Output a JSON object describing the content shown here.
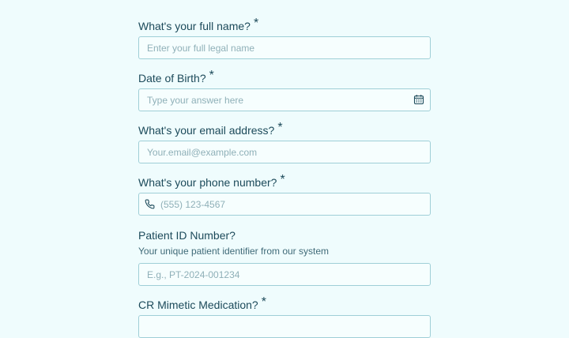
{
  "fields": [
    {
      "label": "What's your full name?",
      "required": "*",
      "placeholder": "Enter your full legal name"
    },
    {
      "label": "Date of Birth?",
      "required": "*",
      "placeholder": "Type your answer here",
      "icon": "calendar-icon"
    },
    {
      "label": "What's your email address?",
      "required": "*",
      "placeholder": "Your.email@example.com"
    },
    {
      "label": "What's your phone number?",
      "required": "*",
      "placeholder": "(555) 123-4567",
      "icon": "phone-icon"
    },
    {
      "label": "Patient ID Number?",
      "help": "Your unique patient identifier from our system",
      "placeholder": "E.g., PT-2024-001234"
    },
    {
      "label": "CR Mimetic Medication?",
      "required": "*"
    }
  ],
  "colors": {
    "background": "#effcfd",
    "text": "#1c4a5a",
    "border": "#9fcfd7",
    "placeholder": "#8fb0b8"
  }
}
